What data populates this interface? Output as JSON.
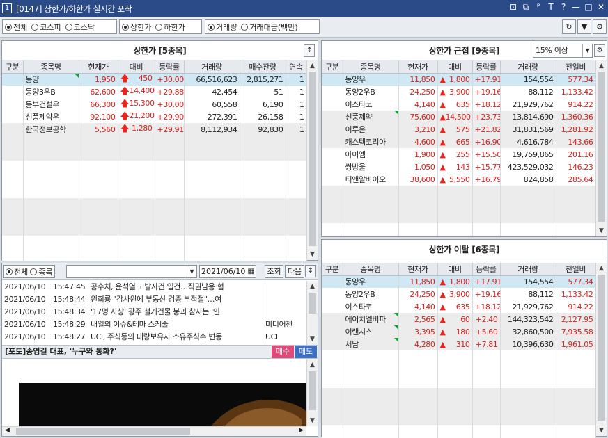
{
  "title": {
    "num": "1",
    "text": "[0147] 상한가/하한가 실시간 포착"
  },
  "window_controls": [
    "⊡",
    "⧉",
    "ᴾ",
    "T",
    "?",
    "—",
    "□",
    "✕"
  ],
  "filters": {
    "market": [
      "전체",
      "코스피",
      "코스닥"
    ],
    "limit": [
      "상한가",
      "하한가"
    ],
    "volume": [
      "거래량",
      "거래대금(백만)"
    ]
  },
  "toolbar_buttons": {
    "refresh": "↻",
    "down": "▼",
    "settings": "⚙"
  },
  "upper_limit": {
    "title": "상한가 [5종목]",
    "columns": [
      "구분",
      "종목명",
      "현재가",
      "대비",
      "등락률",
      "거래량",
      "매수잔량",
      "연속"
    ],
    "rows": [
      {
        "name": "동양",
        "price": "1,950",
        "diff": "450",
        "rate": "+30.00",
        "volume": "66,516,623",
        "bid": "2,815,271",
        "streak": "1",
        "mark": true
      },
      {
        "name": "동양3우B",
        "price": "62,600",
        "diff": "14,400",
        "rate": "+29.88",
        "volume": "42,454",
        "bid": "51",
        "streak": "1",
        "mark": false
      },
      {
        "name": "동부건설우",
        "price": "66,300",
        "diff": "15,300",
        "rate": "+30.00",
        "volume": "60,558",
        "bid": "6,190",
        "streak": "1",
        "mark": false
      },
      {
        "name": "신풍제약우",
        "price": "92,100",
        "diff": "21,200",
        "rate": "+29.90",
        "volume": "272,391",
        "bid": "26,158",
        "streak": "1",
        "mark": false
      },
      {
        "name": "한국정보공학",
        "price": "5,560",
        "diff": "1,280",
        "rate": "+29.91",
        "volume": "8,112,934",
        "bid": "92,830",
        "streak": "1",
        "mark": false
      }
    ]
  },
  "near_limit": {
    "title": "상한가 근접 [9종목]",
    "threshold": "15% 이상",
    "columns": [
      "구분",
      "종목명",
      "현재가",
      "대비",
      "등락률",
      "거래량",
      "전일비"
    ],
    "rows": [
      {
        "name": "동양우",
        "price": "11,850",
        "diff": "1,800",
        "rate": "+17.91",
        "volume": "154,554",
        "prev": "577.34",
        "mark": false
      },
      {
        "name": "동양2우B",
        "price": "24,250",
        "diff": "3,900",
        "rate": "+19.16",
        "volume": "88,112",
        "prev": "1,133.42",
        "mark": false
      },
      {
        "name": "이스타코",
        "price": "4,140",
        "diff": "635",
        "rate": "+18.12",
        "volume": "21,929,762",
        "prev": "914.22",
        "mark": false
      },
      {
        "name": "신풍제약",
        "price": "75,600",
        "diff": "14,500",
        "rate": "+23.73",
        "volume": "13,814,690",
        "prev": "1,360.36",
        "mark": true
      },
      {
        "name": "이루온",
        "price": "3,210",
        "diff": "575",
        "rate": "+21.82",
        "volume": "31,831,569",
        "prev": "1,281.92",
        "mark": false
      },
      {
        "name": "캐스텍코리아",
        "price": "4,600",
        "diff": "665",
        "rate": "+16.90",
        "volume": "4,616,784",
        "prev": "143.66",
        "mark": false
      },
      {
        "name": "아이엠",
        "price": "1,900",
        "diff": "255",
        "rate": "+15.50",
        "volume": "19,759,865",
        "prev": "201.16",
        "mark": false
      },
      {
        "name": "쌍방울",
        "price": "1,050",
        "diff": "143",
        "rate": "+15.77",
        "volume": "423,529,032",
        "prev": "146.23",
        "mark": false
      },
      {
        "name": "티앤알바이오",
        "price": "38,600",
        "diff": "5,550",
        "rate": "+16.79",
        "volume": "824,858",
        "prev": "285.64",
        "mark": false
      }
    ]
  },
  "off_limit": {
    "title": "상한가 이탈 [6종목]",
    "columns": [
      "구분",
      "종목명",
      "현재가",
      "대비",
      "등락률",
      "거래량",
      "전일비"
    ],
    "rows": [
      {
        "name": "동양우",
        "price": "11,850",
        "diff": "1,800",
        "rate": "+17.91",
        "volume": "154,554",
        "prev": "577.34",
        "mark": false
      },
      {
        "name": "동양2우B",
        "price": "24,250",
        "diff": "3,900",
        "rate": "+19.16",
        "volume": "88,112",
        "prev": "1,133.42",
        "mark": false
      },
      {
        "name": "이스타코",
        "price": "4,140",
        "diff": "635",
        "rate": "+18.12",
        "volume": "21,929,762",
        "prev": "914.22",
        "mark": false
      },
      {
        "name": "에이치엘비파",
        "price": "2,565",
        "diff": "60",
        "rate": "+2.40",
        "volume": "144,323,542",
        "prev": "2,127.95",
        "mark": true
      },
      {
        "name": "이랜시스",
        "price": "3,395",
        "diff": "180",
        "rate": "+5.60",
        "volume": "32,860,500",
        "prev": "7,935.58",
        "mark": true
      },
      {
        "name": "서남",
        "price": "4,280",
        "diff": "310",
        "rate": "+7.81",
        "volume": "10,396,630",
        "prev": "1,961.05",
        "mark": true
      }
    ]
  },
  "news": {
    "filter": [
      "전체",
      "종목"
    ],
    "date": "2021/06/10",
    "query_btn": "조회",
    "next_btn": "다음",
    "items": [
      {
        "date": "2021/06/10",
        "time": "15:47:45",
        "title": "공수처, 윤석열 고발사건 입건…직권남용 혐",
        "src": ""
      },
      {
        "date": "2021/06/10",
        "time": "15:48:44",
        "title": "원희룡 \"감사원에 부동산 검증 부적절\"…여",
        "src": ""
      },
      {
        "date": "2021/06/10",
        "time": "15:48:34",
        "title": "'17명 사상' 광주 철거건물 붕괴 참사는 '인",
        "src": ""
      },
      {
        "date": "2021/06/10",
        "time": "15:48:29",
        "title": "내일의 이슈&테마 스케줄",
        "src": "미디어젠"
      },
      {
        "date": "2021/06/10",
        "time": "15:48:27",
        "title": "UCI, 주식등의 대량보유자 소유주식수 변동",
        "src": "UCI"
      }
    ],
    "headline": "[포토]송영길 대표, '누구와 통화?'",
    "buy": "매수",
    "sell": "매도"
  },
  "colors": {
    "up": "#d8231f",
    "select": "#cfe8f4",
    "title_bg": "#2a4a88"
  }
}
